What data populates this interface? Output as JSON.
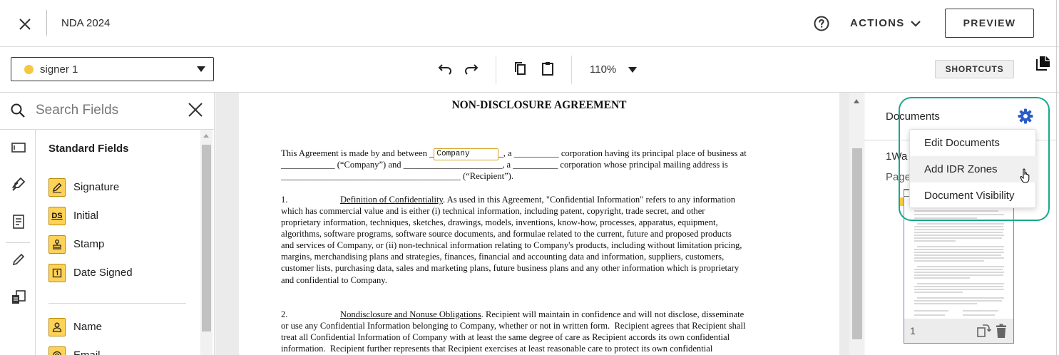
{
  "header": {
    "title": "NDA 2024",
    "actions_label": "ACTIONS",
    "preview_label": "PREVIEW",
    "icons": [
      "close-icon",
      "help-icon",
      "chevron-down-icon"
    ]
  },
  "toolbar": {
    "signer": "signer 1",
    "signer_color": "#f5c842",
    "zoom": "110%",
    "shortcuts_label": "SHORTCUTS",
    "icons": [
      "undo-icon",
      "redo-icon",
      "copy-icon",
      "paste-icon",
      "copy-documents-icon"
    ]
  },
  "sidebar": {
    "search_placeholder": "Search Fields",
    "section_title": "Standard Fields",
    "fields": [
      {
        "label": "Signature",
        "icon": "pen-icon"
      },
      {
        "label": "Initial",
        "icon": "ds-icon"
      },
      {
        "label": "Stamp",
        "icon": "stamp-icon"
      },
      {
        "label": "Date Signed",
        "icon": "calendar-icon"
      },
      {
        "label": "Name",
        "icon": "person-icon"
      },
      {
        "label": "Email",
        "icon": "at-icon"
      }
    ],
    "rail_icons": [
      "standard-fields-icon",
      "custom-fields-icon",
      "document-icon",
      "edit-icon",
      "templates-icon"
    ],
    "field_color": "#fdd257"
  },
  "document": {
    "heading": "NON-DISCLOSURE AGREEMENT",
    "company_tag": "Company",
    "p1_a": "This Agreement is made by and between _",
    "p1_b": "_, a __________ corporation having its principal place of business at",
    "p1_line2": "____________ (“Company”) and ______________________, a __________ corporation whose principal mailing address is",
    "p1_line3": "________________________________________ (“Recipient”).",
    "s1_num": "1.",
    "s1_title": "Definition of Confidentiality",
    "s1_line1": ". As used in this Agreement, \"Confidential Information\" refers to any information",
    "s1_rest": "which has commercial value and is either (i) technical information, including patent, copyright, trade secret, and other\nproprietary information, techniques, sketches, drawings, models, inventions, know-how, processes, apparatus, equipment,\nalgorithms, software programs, software source documents, and formulae related to the current, future and proposed products\nand services of Company, or (ii) non-technical information relating to Company's products, including without limitation pricing,\nmargins, merchandising plans and strategies, finances, financial and accounting data and information, suppliers, customers,\ncustomer lists, purchasing data, sales and marketing plans, future business plans and any other information which is proprietary\nand confidential to Company.",
    "s2_num": "2.",
    "s2_title": "Nondisclosure and Nonuse Obligations",
    "s2_line1": ". Recipient will maintain in confidence and will not disclose, disseminate",
    "s2_rest": "or use any Confidential Information belonging to Company, whether or not in written form.  Recipient agrees that Recipient shall\ntreat all Confidential Information of Company with at least the same degree of care as Recipient accords its own confidential\ninformation.  Recipient further represents that Recipient exercises at least reasonable care to protect its own confidential"
  },
  "right_panel": {
    "title": "Documents",
    "doc_name": "1Wa",
    "pages_label": "Page",
    "thumb_page": "1",
    "menu": [
      {
        "label": "Edit Documents"
      },
      {
        "label": "Add IDR Zones"
      },
      {
        "label": "Document Visibility"
      }
    ],
    "accent": "#2a5cc8",
    "highlight_color": "#1aa889"
  }
}
